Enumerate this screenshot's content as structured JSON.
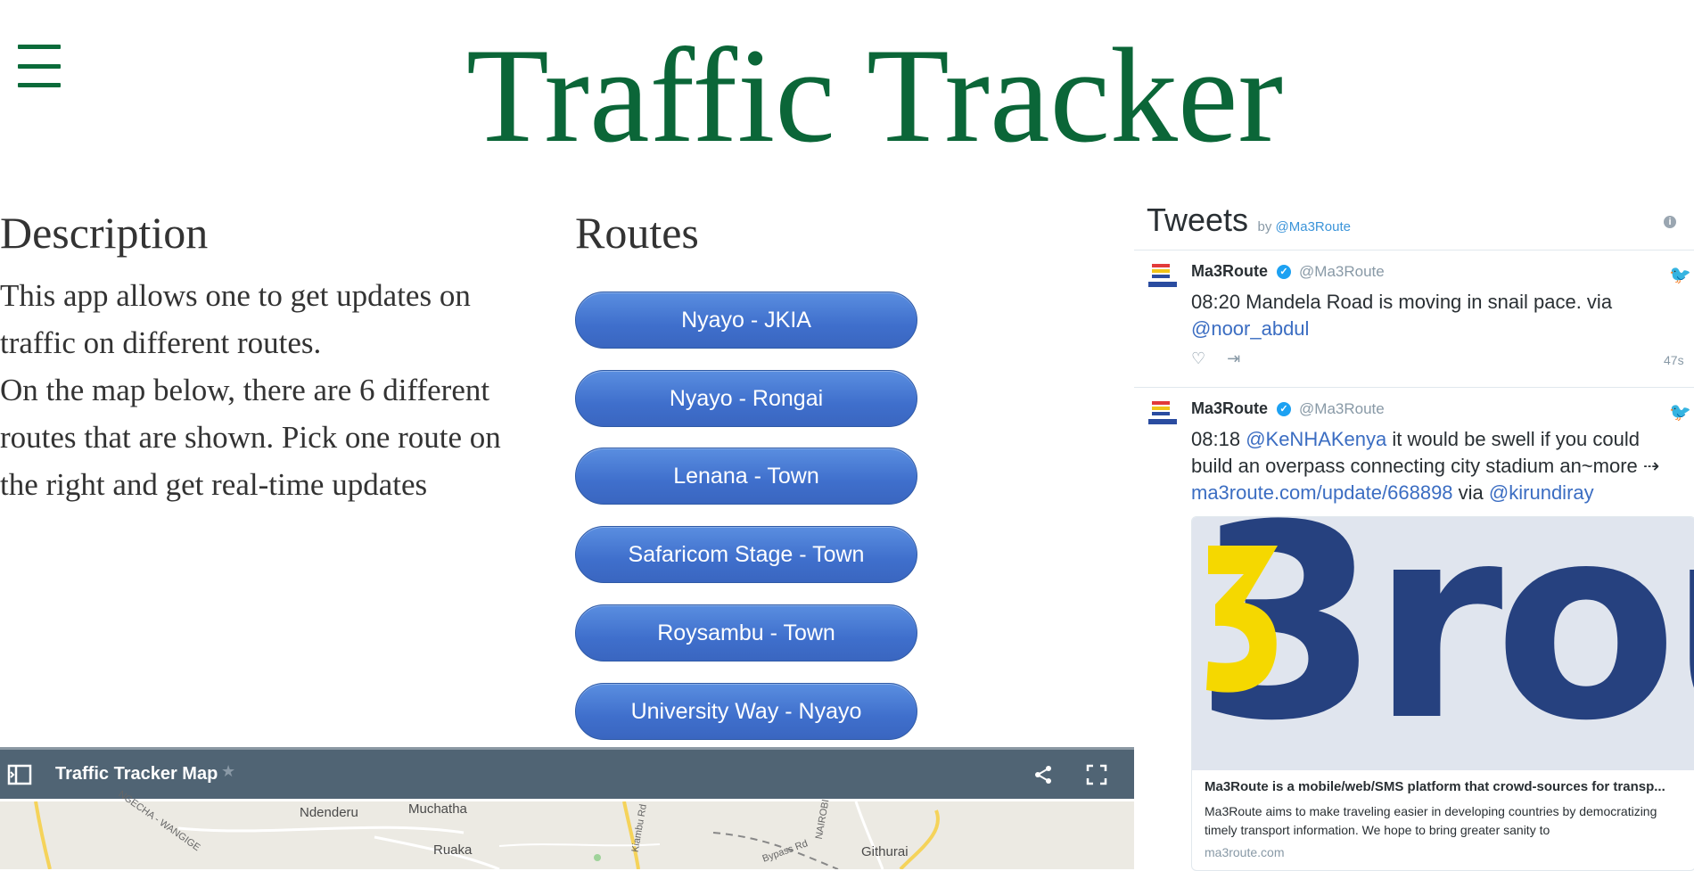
{
  "header": {
    "title": "Traffic Tracker",
    "menu_icon": "hamburger-menu-icon"
  },
  "description": {
    "heading": "Description",
    "text_line1": "This app allows one to get updates on traffic on different routes.",
    "text_line2": "On the map below, there are 6 different routes that are shown. Pick one route on the right and get real-time updates"
  },
  "routes": {
    "heading": "Routes",
    "items": [
      {
        "label": "Nyayo - JKIA"
      },
      {
        "label": "Nyayo - Rongai"
      },
      {
        "label": "Lenana - Town"
      },
      {
        "label": "Safaricom Stage - Town"
      },
      {
        "label": "Roysambu - Town"
      },
      {
        "label": "University Way - Nyayo"
      }
    ],
    "button_color": "#3f6fcc"
  },
  "map": {
    "title": "Traffic Tracker Map",
    "labels": [
      "Ndenderu",
      "Muchatha",
      "Ruaka",
      "Githurai",
      "Kiambu Rd",
      "NGECHA - WANGIGE",
      "NAIROBI",
      "Bypass Rd"
    ],
    "bar_color": "#506474"
  },
  "tweets": {
    "title": "Tweets",
    "by_prefix": "by",
    "by_handle": "@Ma3Route",
    "items": [
      {
        "name": "Ma3Route",
        "handle": "@Ma3Route",
        "text_plain": "08:20 Mandela Road is moving in snail pace. via",
        "mention": "@noor_abdul",
        "time": "47s"
      },
      {
        "name": "Ma3Route",
        "handle": "@Ma3Route",
        "time_prefix": "08:18",
        "mention1": "@KeNHAKenya",
        "text_mid": "it would be swell if you could build an overpass connecting city stadium an~more ⇢",
        "link": "ma3route.com/update/668898",
        "via": "via",
        "mention2": "@kirundiray",
        "card": {
          "image_text": "3rou",
          "title": "Ma3Route is a mobile/web/SMS platform that crowd-sources for transp...",
          "description": "Ma3Route aims to make traveling easier in developing countries by democratizing timely transport information. We hope to bring greater sanity to",
          "domain": "ma3route.com"
        }
      }
    ]
  },
  "colors": {
    "title_green": "#0b6638",
    "link_blue": "#3b6dc2"
  }
}
